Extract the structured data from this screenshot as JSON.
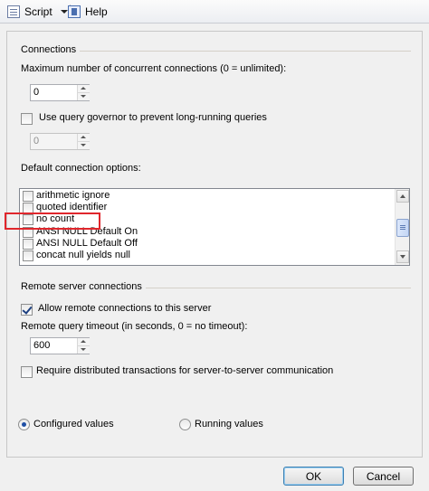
{
  "toolbar": {
    "script_label": "Script",
    "help_label": "Help"
  },
  "connections": {
    "title": "Connections",
    "max_connections_label": "Maximum number of concurrent connections (0 = unlimited):",
    "max_connections_value": "0",
    "query_governor_label": "Use query governor to prevent long-running queries",
    "query_governor_checked": false,
    "query_governor_value": "0",
    "default_options_label": "Default connection options:",
    "options": [
      {
        "label": "arithmetic ignore",
        "checked": false
      },
      {
        "label": "quoted identifier",
        "checked": false
      },
      {
        "label": "no count",
        "checked": false
      },
      {
        "label": "ANSI NULL Default On",
        "checked": false
      },
      {
        "label": "ANSI NULL Default Off",
        "checked": false
      },
      {
        "label": "concat null yields null",
        "checked": false
      }
    ]
  },
  "remote": {
    "title": "Remote server connections",
    "allow_remote_label": "Allow remote connections to this server",
    "allow_remote_checked": true,
    "timeout_label": "Remote query timeout (in seconds, 0 = no timeout):",
    "timeout_value": "600",
    "distributed_label": "Require distributed transactions for server-to-server communication",
    "distributed_checked": false
  },
  "view_mode": {
    "configured_label": "Configured values",
    "running_label": "Running values",
    "selected": "configured"
  },
  "footer": {
    "ok_label": "OK",
    "cancel_label": "Cancel"
  },
  "annotation": {
    "highlight_color": "#e0262c"
  }
}
